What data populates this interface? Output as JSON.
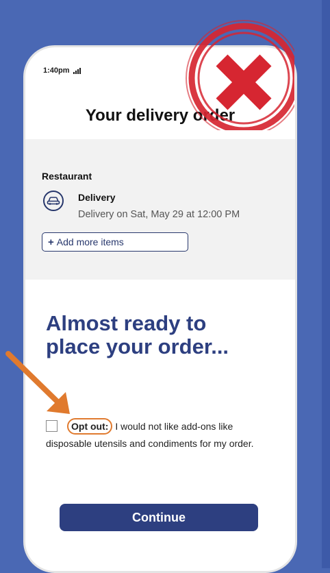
{
  "status_bar": {
    "time": "1:40pm"
  },
  "header": {
    "title": "Your delivery order"
  },
  "order_card": {
    "section_label": "Restaurant",
    "delivery_icon": "car-icon",
    "delivery_title": "Delivery",
    "delivery_detail": "Delivery on Sat, May 29 at 12:00 PM",
    "add_items_label": "Add more items"
  },
  "main": {
    "headline_line1": "Almost ready to",
    "headline_line2": "place your order...",
    "opt_out_label": "Opt out:",
    "opt_out_text": "I would not like add-ons like disposable utensils and condiments for my order.",
    "continue_label": "Continue"
  },
  "colors": {
    "background": "#4a68b4",
    "brand_navy": "#2d3f80",
    "annotation_orange": "#e07a2e",
    "stamp_red": "#d62631"
  }
}
